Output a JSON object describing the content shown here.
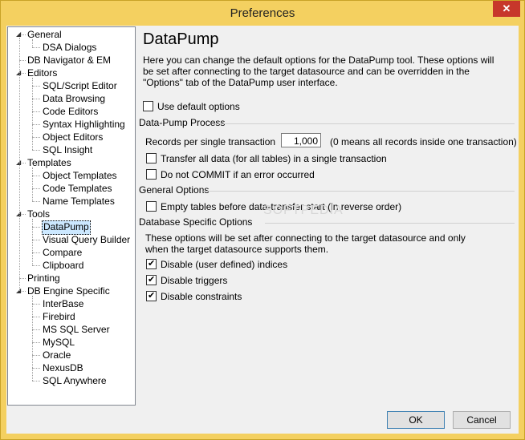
{
  "window": {
    "title": "Preferences",
    "close_glyph": "✕"
  },
  "tree": {
    "items": [
      {
        "label": "General",
        "expanded": true
      },
      {
        "label": "DSA Dialogs"
      },
      {
        "label": "DB Navigator & EM"
      },
      {
        "label": "Editors",
        "expanded": true
      },
      {
        "label": "SQL/Script Editor"
      },
      {
        "label": "Data Browsing"
      },
      {
        "label": "Code Editors"
      },
      {
        "label": "Syntax Highlighting"
      },
      {
        "label": "Object Editors"
      },
      {
        "label": "SQL Insight"
      },
      {
        "label": "Templates",
        "expanded": true
      },
      {
        "label": "Object Templates"
      },
      {
        "label": "Code Templates"
      },
      {
        "label": "Name Templates"
      },
      {
        "label": "Tools",
        "expanded": true
      },
      {
        "label": "DataPump",
        "selected": true
      },
      {
        "label": "Visual Query Builder"
      },
      {
        "label": "Compare"
      },
      {
        "label": "Clipboard"
      },
      {
        "label": "Printing"
      },
      {
        "label": "DB Engine Specific",
        "expanded": true
      },
      {
        "label": "InterBase"
      },
      {
        "label": "Firebird"
      },
      {
        "label": "MS SQL Server"
      },
      {
        "label": "MySQL"
      },
      {
        "label": "Oracle"
      },
      {
        "label": "NexusDB"
      },
      {
        "label": "SQL Anywhere"
      }
    ]
  },
  "page": {
    "title": "DataPump",
    "description": "Here you can change the default options for the DataPump tool. These options will be set after connecting to the target datasource and can be overridden in the \"Options\" tab of the DataPump user interface.",
    "use_default": {
      "label": "Use default options",
      "checked": false
    },
    "datapump_process": {
      "heading": "Data-Pump Process",
      "records_label": "Records per single transaction",
      "records_value": "1,000",
      "records_note": "(0 means all records inside one transaction)",
      "transfer_all": {
        "label": "Transfer all data (for all tables) in a single transaction",
        "checked": false
      },
      "no_commit": {
        "label": "Do not COMMIT if an error occurred",
        "checked": false
      }
    },
    "general_options": {
      "heading": "General Options",
      "empty_tables": {
        "label": "Empty tables before data-transfer start (in reverse order)",
        "checked": false
      }
    },
    "db_specific": {
      "heading": "Database Specific Options",
      "note": "These options will be set after connecting to the target datasource and only when the target datasource supports them.",
      "disable_indices": {
        "label": "Disable (user defined) indices",
        "checked": true
      },
      "disable_triggers": {
        "label": "Disable triggers",
        "checked": true
      },
      "disable_constraints": {
        "label": "Disable constraints",
        "checked": true
      }
    }
  },
  "buttons": {
    "ok": "OK",
    "cancel": "Cancel"
  },
  "watermark": "SOFTPEDIA"
}
